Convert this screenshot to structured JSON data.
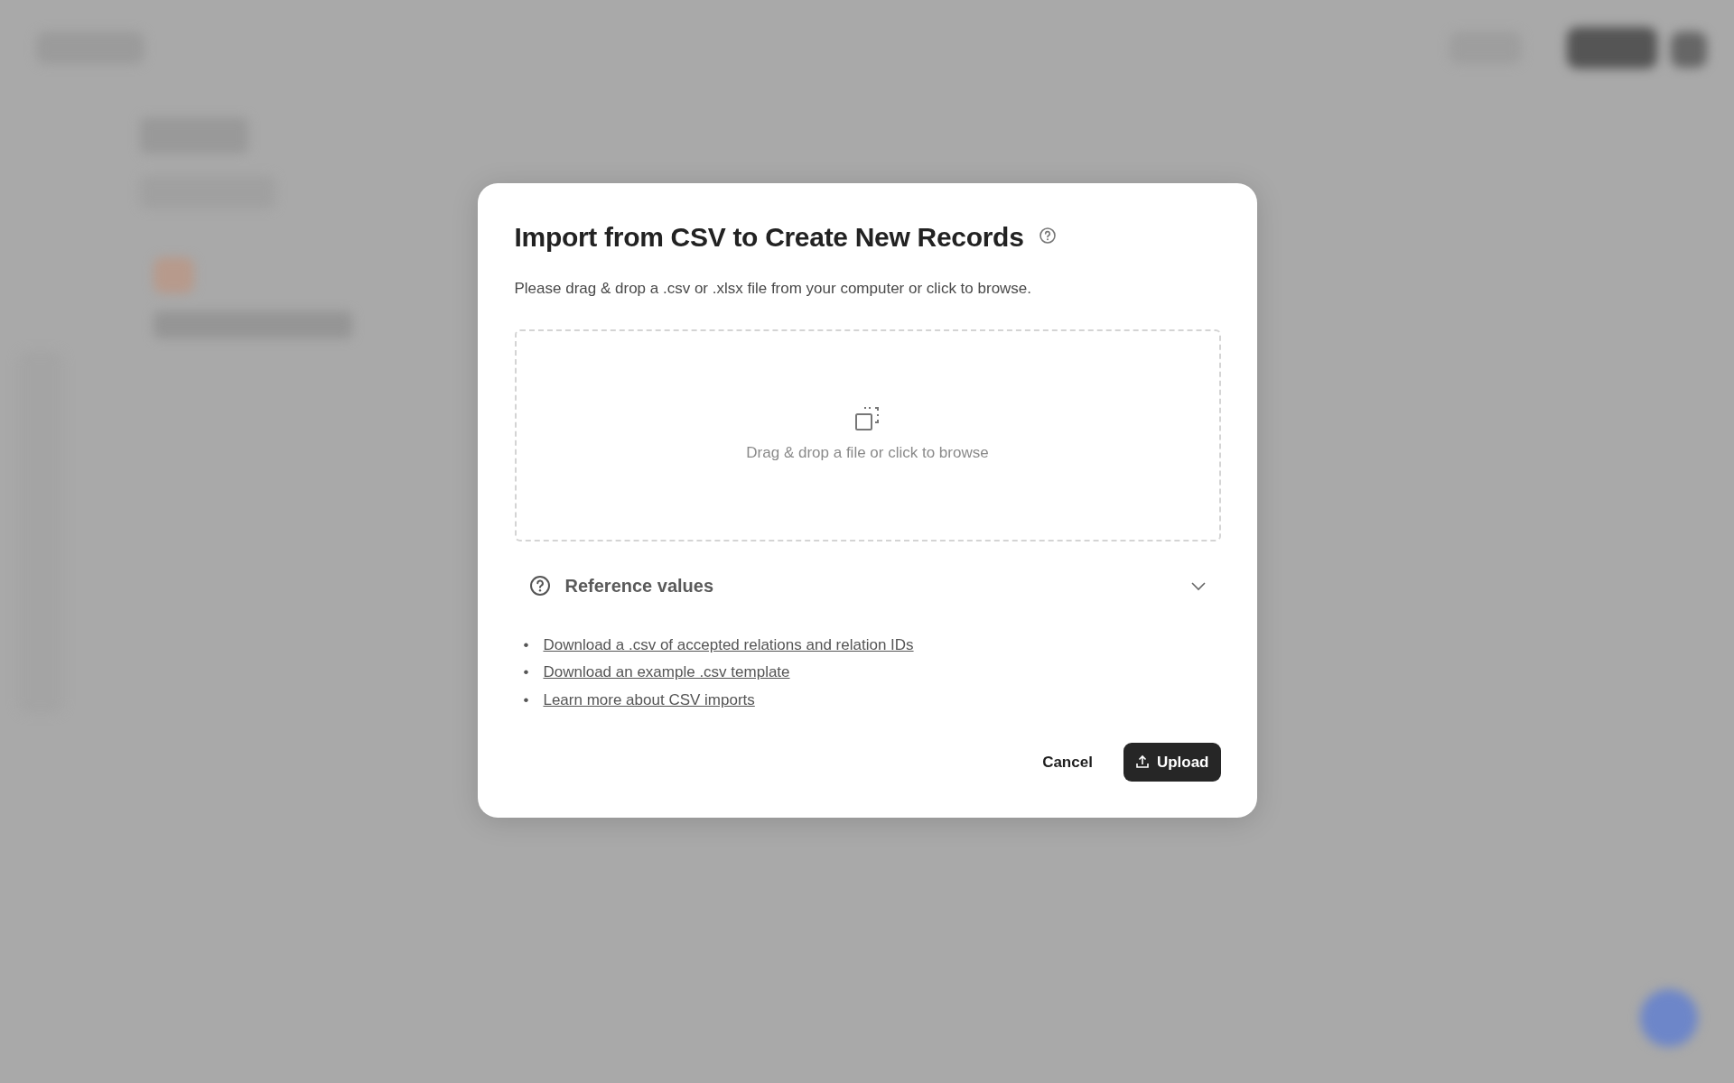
{
  "dialog": {
    "title": "Import from CSV to Create New Records",
    "description": "Please drag & drop a .csv or .xlsx file from your computer or click to browse.",
    "dropzone": {
      "label": "Drag & drop a file or click to browse"
    },
    "reference": {
      "label": "Reference values",
      "expanded": true,
      "links": [
        {
          "marker": "•",
          "label": "Download a .csv of accepted relations and relation IDs"
        },
        {
          "marker": "•",
          "label": "Download an example .csv template"
        },
        {
          "marker": "•",
          "label": "Learn more about CSV imports"
        }
      ]
    },
    "buttons": [
      {
        "label": "Cancel",
        "kind": "secondary"
      },
      {
        "label": "Upload",
        "kind": "primary"
      }
    ]
  }
}
